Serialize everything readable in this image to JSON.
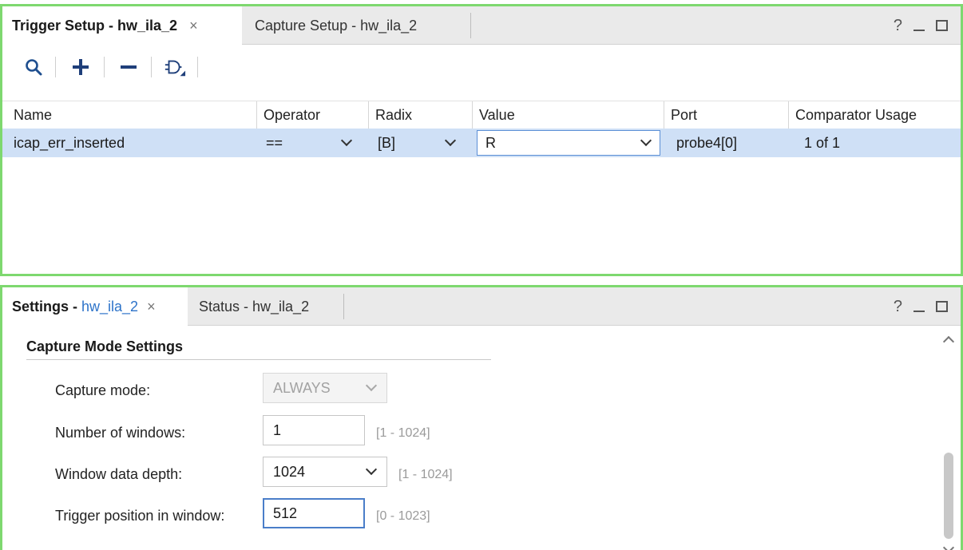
{
  "trigger_panel": {
    "tabs": [
      {
        "label": "Trigger Setup - hw_ila_2",
        "close": "×"
      },
      {
        "label": "Capture Setup - hw_ila_2"
      }
    ],
    "window_controls": {
      "help": "?"
    },
    "toolbar": {
      "icons": [
        "search-icon",
        "add-icon",
        "remove-icon",
        "gate-icon"
      ]
    },
    "columns": [
      "Name",
      "Operator",
      "Radix",
      "Value",
      "Port",
      "Comparator Usage"
    ],
    "rows": [
      {
        "name": "icap_err_inserted",
        "operator": "==",
        "radix": "[B]",
        "value": "R",
        "port": "probe4[0]",
        "comparator_usage": "1 of 1"
      }
    ],
    "selection_color": "#cfe0f6"
  },
  "settings_panel": {
    "tabs": [
      {
        "label_prefix": "Settings - ",
        "label_highlight": "hw_ila_2",
        "close": "×"
      },
      {
        "label": "Status - hw_ila_2"
      }
    ],
    "window_controls": {
      "help": "?"
    },
    "section_title": "Capture Mode Settings",
    "fields": {
      "capture_mode": {
        "label": "Capture mode:",
        "value": "ALWAYS"
      },
      "num_windows": {
        "label": "Number of windows:",
        "value": "1",
        "range": "[1 - 1024]"
      },
      "window_depth": {
        "label": "Window data depth:",
        "value": "1024",
        "range": "[1 - 1024]"
      },
      "trigger_position": {
        "label": "Trigger position in window:",
        "value": "512",
        "range": "[0 - 1023]"
      }
    },
    "accent_color": "#2d73c9"
  },
  "frame_color": "#7ed86f"
}
